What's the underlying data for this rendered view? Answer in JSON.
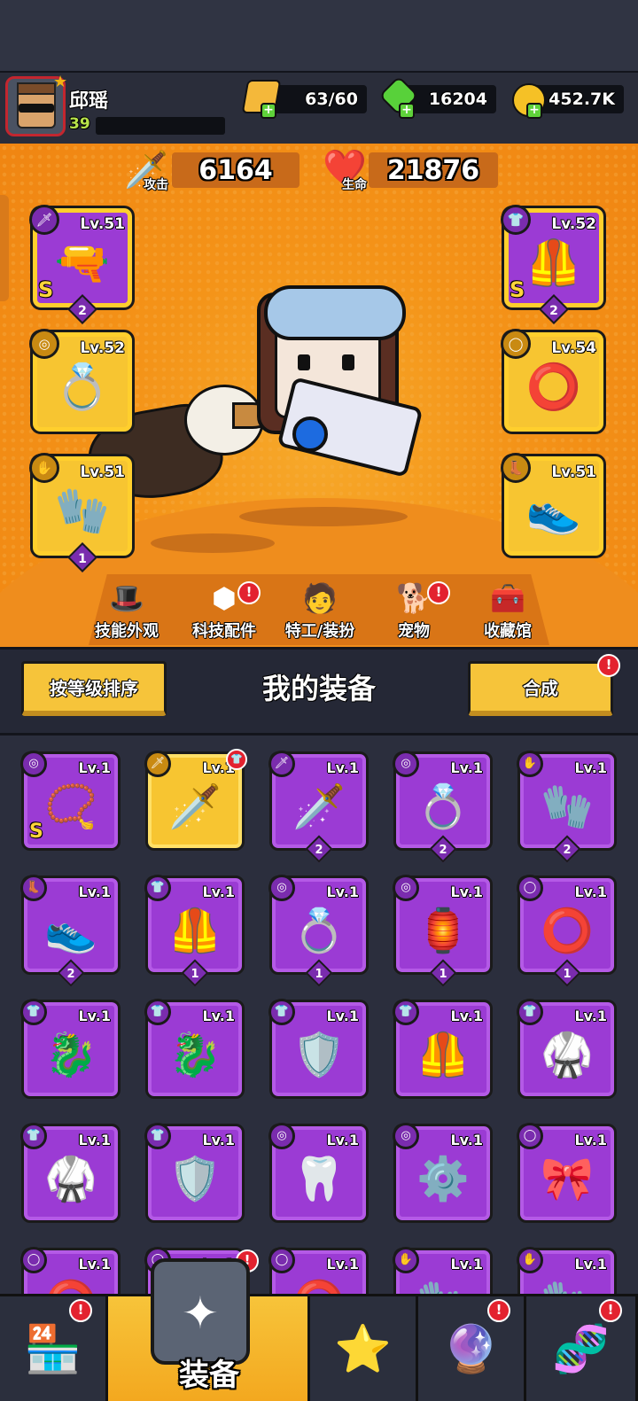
{
  "player": {
    "name": "邱瑶",
    "level": "39"
  },
  "resources": {
    "energy": "63/60",
    "gems": "16204",
    "coins": "452.7K"
  },
  "stats": {
    "attack_value": "6164",
    "attack_label": "攻击",
    "hp_value": "21876",
    "hp_label": "生命"
  },
  "equipped": {
    "left": [
      {
        "name": "weapon",
        "icon": "blaster-icon",
        "glyph": "🔫",
        "level": "Lv.51",
        "rank": "S",
        "stars": "2",
        "cat": "🗡",
        "rarity": "purple"
      },
      {
        "name": "ring",
        "icon": "ring-icon",
        "glyph": "💍",
        "level": "Lv.52",
        "rank": "",
        "stars": "",
        "cat": "◎",
        "rarity": "gold"
      },
      {
        "name": "gloves",
        "icon": "glove-icon",
        "glyph": "🧤",
        "level": "Lv.51",
        "rank": "",
        "stars": "1",
        "cat": "✋",
        "rarity": "gold"
      }
    ],
    "right": [
      {
        "name": "armor",
        "icon": "armor-icon",
        "glyph": "🦺",
        "level": "Lv.52",
        "rank": "S",
        "stars": "2",
        "cat": "👕",
        "rarity": "purple"
      },
      {
        "name": "belt",
        "icon": "belt-icon",
        "glyph": "⭕",
        "level": "Lv.54",
        "rank": "",
        "stars": "",
        "cat": "◯",
        "rarity": "gold"
      },
      {
        "name": "boots",
        "icon": "boot-icon",
        "glyph": "👟",
        "level": "Lv.51",
        "rank": "",
        "stars": "",
        "cat": "👢",
        "rarity": "gold"
      }
    ]
  },
  "tabs": [
    {
      "label": "技能外观",
      "icon": "hat-ball-icon",
      "glyph": "🎩",
      "badge": false
    },
    {
      "label": "科技配件",
      "icon": "hex-chip-icon",
      "glyph": "⬢",
      "badge": true
    },
    {
      "label": "特工/装扮",
      "icon": "agent-icon",
      "glyph": "🧑",
      "badge": false
    },
    {
      "label": "宠物",
      "icon": "dog-icon",
      "glyph": "🐕",
      "badge": true
    },
    {
      "label": "收藏馆",
      "icon": "chest-icon",
      "glyph": "🧰",
      "badge": false
    }
  ],
  "inventory": {
    "title": "我的装备",
    "sort_label": "按等级排序",
    "merge_label": "合成",
    "badge": "!",
    "items": [
      {
        "icon": "necklace-icon",
        "glyph": "📿",
        "level": "Lv.1",
        "rank": "S",
        "stars": "",
        "cat": "◎",
        "gold": false,
        "red": false
      },
      {
        "icon": "kunai-icon",
        "glyph": "🗡️",
        "level": "Lv.1",
        "rank": "",
        "stars": "",
        "cat": "🗡",
        "gold": true,
        "red": true
      },
      {
        "icon": "kunai-icon",
        "glyph": "🗡️",
        "level": "Lv.1",
        "rank": "",
        "stars": "2",
        "cat": "🗡",
        "gold": false,
        "red": false
      },
      {
        "icon": "ring-icon",
        "glyph": "💍",
        "level": "Lv.1",
        "rank": "",
        "stars": "2",
        "cat": "◎",
        "gold": false,
        "red": false
      },
      {
        "icon": "glove-icon",
        "glyph": "🧤",
        "level": "Lv.1",
        "rank": "",
        "stars": "2",
        "cat": "✋",
        "gold": false,
        "red": false
      },
      {
        "icon": "boot-icon",
        "glyph": "👟",
        "level": "Lv.1",
        "rank": "",
        "stars": "2",
        "cat": "👢",
        "gold": false,
        "red": false
      },
      {
        "icon": "armor-icon",
        "glyph": "🦺",
        "level": "Lv.1",
        "rank": "",
        "stars": "1",
        "cat": "👕",
        "gold": false,
        "red": false
      },
      {
        "icon": "ring-icon",
        "glyph": "💍",
        "level": "Lv.1",
        "rank": "",
        "stars": "1",
        "cat": "◎",
        "gold": false,
        "red": false
      },
      {
        "icon": "pendant-icon",
        "glyph": "🏮",
        "level": "Lv.1",
        "rank": "",
        "stars": "1",
        "cat": "◎",
        "gold": false,
        "red": false
      },
      {
        "icon": "belt-icon",
        "glyph": "⭕",
        "level": "Lv.1",
        "rank": "",
        "stars": "1",
        "cat": "◯",
        "gold": false,
        "red": false
      },
      {
        "icon": "dragon-armor-icon",
        "glyph": "🐉",
        "level": "Lv.1",
        "rank": "",
        "stars": "",
        "cat": "👕",
        "gold": false,
        "red": false
      },
      {
        "icon": "dragon-armor-icon",
        "glyph": "🐉",
        "level": "Lv.1",
        "rank": "",
        "stars": "",
        "cat": "👕",
        "gold": false,
        "red": false
      },
      {
        "icon": "armor-icon",
        "glyph": "🛡️",
        "level": "Lv.1",
        "rank": "",
        "stars": "",
        "cat": "👕",
        "gold": false,
        "red": false
      },
      {
        "icon": "armor-icon",
        "glyph": "🦺",
        "level": "Lv.1",
        "rank": "",
        "stars": "",
        "cat": "👕",
        "gold": false,
        "red": false
      },
      {
        "icon": "vest-icon",
        "glyph": "🥋",
        "level": "Lv.1",
        "rank": "",
        "stars": "",
        "cat": "👕",
        "gold": false,
        "red": false
      },
      {
        "icon": "vest-icon",
        "glyph": "🥋",
        "level": "Lv.1",
        "rank": "",
        "stars": "",
        "cat": "👕",
        "gold": false,
        "red": false
      },
      {
        "icon": "armor-icon",
        "glyph": "🛡️",
        "level": "Lv.1",
        "rank": "",
        "stars": "",
        "cat": "👕",
        "gold": false,
        "red": false
      },
      {
        "icon": "fang-necklace-icon",
        "glyph": "🦷",
        "level": "Lv.1",
        "rank": "",
        "stars": "",
        "cat": "◎",
        "gold": false,
        "red": false
      },
      {
        "icon": "spike-collar-icon",
        "glyph": "⚙️",
        "level": "Lv.1",
        "rank": "",
        "stars": "",
        "cat": "◎",
        "gold": false,
        "red": false
      },
      {
        "icon": "belt-icon",
        "glyph": "🎀",
        "level": "Lv.1",
        "rank": "",
        "stars": "",
        "cat": "◯",
        "gold": false,
        "red": false
      },
      {
        "icon": "belt-icon",
        "glyph": "⭕",
        "level": "Lv.1",
        "rank": "",
        "stars": "",
        "cat": "◯",
        "gold": false,
        "red": false
      },
      {
        "icon": "belt-icon",
        "glyph": "⭕",
        "level": "Lv.1",
        "rank": "",
        "stars": "",
        "cat": "◯",
        "gold": false,
        "red": false
      },
      {
        "icon": "belt-icon",
        "glyph": "⭕",
        "level": "Lv.1",
        "rank": "",
        "stars": "",
        "cat": "◯",
        "gold": false,
        "red": false
      },
      {
        "icon": "glove-icon",
        "glyph": "🧤",
        "level": "Lv.1",
        "rank": "",
        "stars": "",
        "cat": "✋",
        "gold": false,
        "red": false
      },
      {
        "icon": "glove-icon",
        "glyph": "🧤",
        "level": "Lv.1",
        "rank": "",
        "stars": "",
        "cat": "✋",
        "gold": false,
        "red": false
      }
    ]
  },
  "nav": {
    "active_label": "装备",
    "items": [
      {
        "name": "shop",
        "icon": "shop-icon",
        "glyph": "🏪",
        "badge": true
      },
      {
        "name": "equipment",
        "icon": "equipment-icon",
        "glyph": "",
        "badge": true
      },
      {
        "name": "battle",
        "icon": "crossed-swords-star-icon",
        "glyph": "⭐",
        "badge": false
      },
      {
        "name": "planet",
        "icon": "planet-icon",
        "glyph": "🔮",
        "badge": true
      },
      {
        "name": "evolve",
        "icon": "dna-icon",
        "glyph": "🧬",
        "badge": true
      }
    ]
  }
}
